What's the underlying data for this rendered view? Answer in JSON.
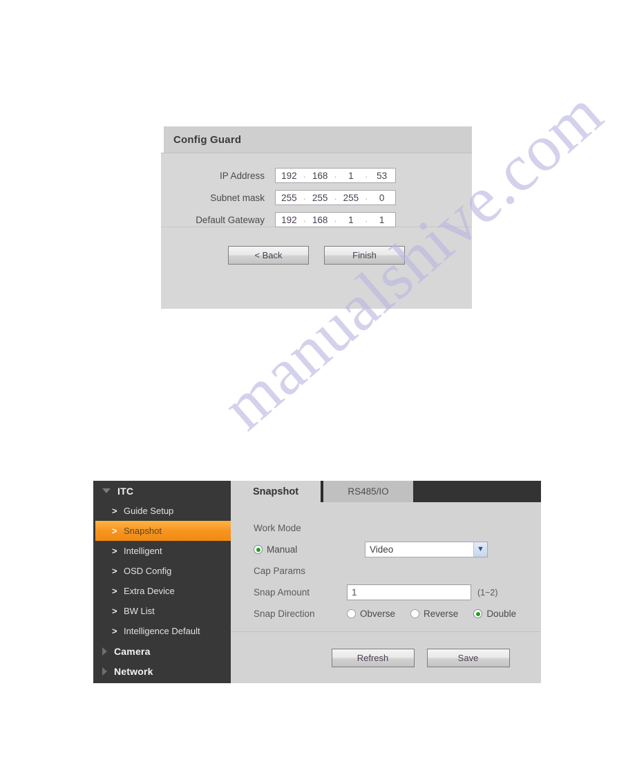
{
  "watermark": {
    "text": "manualshive.com"
  },
  "config_guard": {
    "title": "Config Guard",
    "fields": [
      {
        "label": "IP Address",
        "octets": [
          "192",
          "168",
          "1",
          "53"
        ]
      },
      {
        "label": "Subnet mask",
        "octets": [
          "255",
          "255",
          "255",
          "0"
        ]
      },
      {
        "label": "Default Gateway",
        "octets": [
          "192",
          "168",
          "1",
          "1"
        ]
      }
    ],
    "buttons": {
      "back": "< Back",
      "finish": "Finish"
    },
    "separator": "."
  },
  "snapshot_page": {
    "sidebar": {
      "groups": [
        {
          "label": "ITC",
          "icon": "triangle-down-icon",
          "expanded": true,
          "items": [
            {
              "label": "Guide Setup",
              "icon": "chevron-right-icon",
              "active": false
            },
            {
              "label": "Snapshot",
              "icon": "chevron-right-icon",
              "active": true
            },
            {
              "label": "Intelligent",
              "icon": "chevron-right-icon",
              "active": false
            },
            {
              "label": "OSD Config",
              "icon": "chevron-right-icon",
              "active": false
            },
            {
              "label": "Extra Device",
              "icon": "chevron-right-icon",
              "active": false
            },
            {
              "label": "BW List",
              "icon": "chevron-right-icon",
              "active": false
            },
            {
              "label": "Intelligence Default",
              "icon": "chevron-right-icon",
              "active": false
            }
          ]
        },
        {
          "label": "Camera",
          "icon": "triangle-right-icon",
          "expanded": false,
          "items": []
        },
        {
          "label": "Network",
          "icon": "triangle-right-icon",
          "expanded": false,
          "items": []
        }
      ],
      "chevron_glyph": ">"
    },
    "tabs": [
      {
        "label": "Snapshot",
        "active": true
      },
      {
        "label": "RS485/IO",
        "active": false
      }
    ],
    "form": {
      "work_mode_label": "Work Mode",
      "manual_radio": {
        "label": "Manual",
        "checked": true
      },
      "work_mode_select": {
        "value": "Video",
        "arrow_icon": "chevron-down-icon"
      },
      "cap_params_label": "Cap Params",
      "snap_amount": {
        "label": "Snap Amount",
        "value": "1",
        "hint": "(1~2)"
      },
      "snap_direction": {
        "label": "Snap Direction",
        "options": [
          {
            "label": "Obverse",
            "checked": false
          },
          {
            "label": "Reverse",
            "checked": false
          },
          {
            "label": "Double",
            "checked": true
          }
        ]
      }
    },
    "buttons": {
      "refresh": "Refresh",
      "save": "Save"
    }
  },
  "colors": {
    "sidebar_bg": "#383838",
    "accent_orange": "#f79520",
    "panel_bg": "#d3d3d3",
    "radio_green": "#19a319",
    "watermark": "#b9b6e0"
  }
}
